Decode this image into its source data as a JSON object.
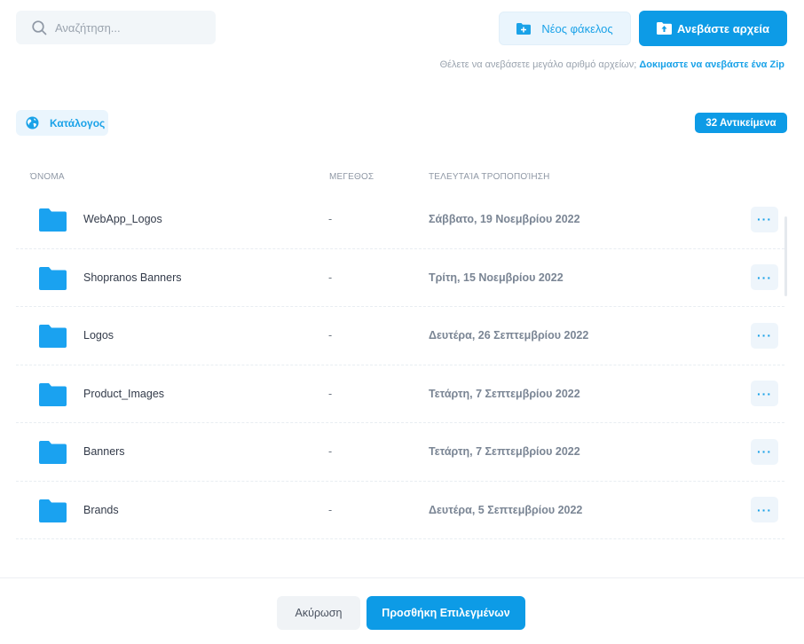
{
  "search": {
    "placeholder": "Αναζήτηση..."
  },
  "toolbar": {
    "new_folder_label": "Νέος φάκελος",
    "upload_label": "Ανεβάστε αρχεία",
    "hint_text": "Θέλετε να ανεβάσετε μεγάλο αριθμό αρχείων; ",
    "hint_link": "Δοκιμαστε να ανεβάστε ένα Zip"
  },
  "breadcrumb": {
    "label": "Κατάλογος"
  },
  "count_badge": "32 Αντικείμενα",
  "table": {
    "headers": {
      "name": "ΌΝΟΜΑ",
      "size": "ΜΕΓΕΘΟΣ",
      "modified": "ΤΕΛΕΥΤΑΊΑ ΤΡΟΠΟΠΟΊΗΣΗ"
    },
    "rows": [
      {
        "name": "WebApp_Logos",
        "size": "-",
        "modified": "Σάββατο, 19 Νοεμβρίου 2022",
        "more": "···"
      },
      {
        "name": "Shopranos Banners",
        "size": "-",
        "modified": "Τρίτη, 15 Νοεμβρίου 2022",
        "more": "···"
      },
      {
        "name": "Logos",
        "size": "-",
        "modified": "Δευτέρα, 26 Σεπτεμβρίου 2022",
        "more": "···"
      },
      {
        "name": "Product_Images",
        "size": "-",
        "modified": "Τετάρτη, 7 Σεπτεμβρίου 2022",
        "more": "···"
      },
      {
        "name": "Banners",
        "size": "-",
        "modified": "Τετάρτη, 7 Σεπτεμβρίου 2022",
        "more": "···"
      },
      {
        "name": "Brands",
        "size": "-",
        "modified": "Δευτέρα, 5 Σεπτεμβρίου 2022",
        "more": "···"
      }
    ]
  },
  "footer": {
    "cancel_label": "Ακύρωση",
    "add_label": "Προσθήκη Επιλεγμένων"
  },
  "colors": {
    "accent": "#0d9be6",
    "accent_light": "#eaf5fd",
    "folder": "#1aa2f0"
  },
  "icons": {
    "search": "search-icon",
    "new_folder": "folder-plus-icon",
    "upload": "upload-folder-icon",
    "catalog": "globe-icon",
    "folder": "folder-icon",
    "more": "more-icon"
  }
}
